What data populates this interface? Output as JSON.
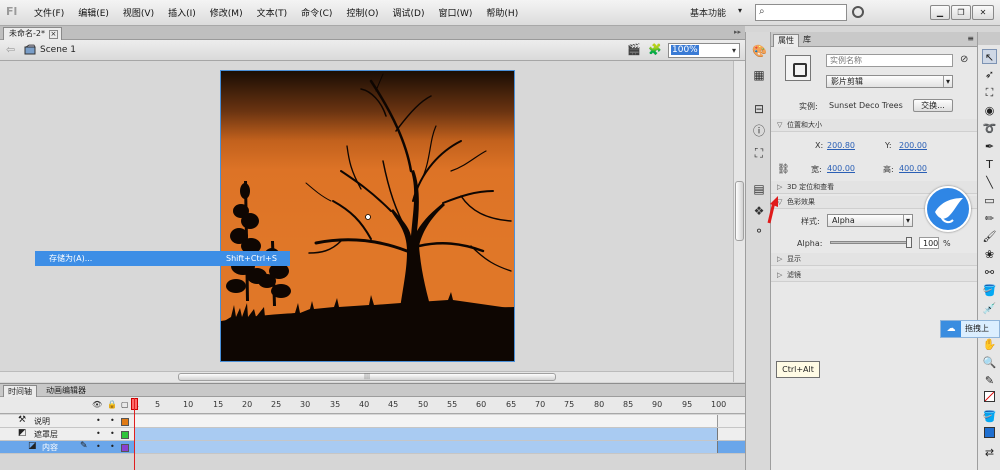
{
  "app": {
    "logo": "Fl",
    "menu": [
      "文件(F)",
      "编辑(E)",
      "视图(V)",
      "插入(I)",
      "修改(M)",
      "文本(T)",
      "命令(C)",
      "控制(O)",
      "调试(D)",
      "窗口(W)",
      "帮助(H)"
    ],
    "workspace": "基本功能",
    "search_placeholder": ""
  },
  "document": {
    "tab_name": "未命名-2*",
    "scene": "Scene 1",
    "zoom": "100%"
  },
  "context_menu": {
    "item_label": "存储为(A)...",
    "shortcut": "Shift+Ctrl+S"
  },
  "timeline": {
    "tabs": [
      "时间轴",
      "动画编辑器"
    ],
    "ruler": [
      "1",
      "5",
      "10",
      "15",
      "20",
      "25",
      "30",
      "35",
      "40",
      "45",
      "50",
      "55",
      "60",
      "65",
      "70",
      "75",
      "80",
      "85",
      "90",
      "95",
      "100"
    ],
    "layers": [
      {
        "name": "说明",
        "color": "#e07a14",
        "selected": false
      },
      {
        "name": "遮罩层",
        "color": "#2ec43a",
        "selected": false
      },
      {
        "name": "内容",
        "color": "#8a3fd1",
        "selected": true
      }
    ]
  },
  "properties": {
    "tabs": [
      "属性",
      "库"
    ],
    "instance_name_placeholder": "实例名称",
    "symbol_type": "影片剪辑",
    "instance_label": "实例:",
    "instance_value": "Sunset Deco Trees",
    "swap_button": "交换...",
    "section_position": "位置和大小",
    "x_label": "X:",
    "x_value": "200.80",
    "y_label": "Y:",
    "y_value": "200.00",
    "w_label": "宽:",
    "w_value": "400.00",
    "h_label": "高:",
    "h_value": "400.00",
    "section_3d": "3D 定位和查看",
    "section_color": "色彩效果",
    "style_label": "样式:",
    "style_value": "Alpha",
    "alpha_label": "Alpha:",
    "alpha_value": "100",
    "alpha_unit": "%",
    "alpha_level": 1.0,
    "section_display": "显示",
    "section_filter": "滤镜"
  },
  "overlays": {
    "tooltip": "Ctrl+Alt",
    "badge_text": "拖拽上"
  },
  "colors": {
    "selection_blue": "#3d8ee6",
    "stage_orange": "#e07728",
    "layer_row_blue": "#a9cbf2"
  }
}
